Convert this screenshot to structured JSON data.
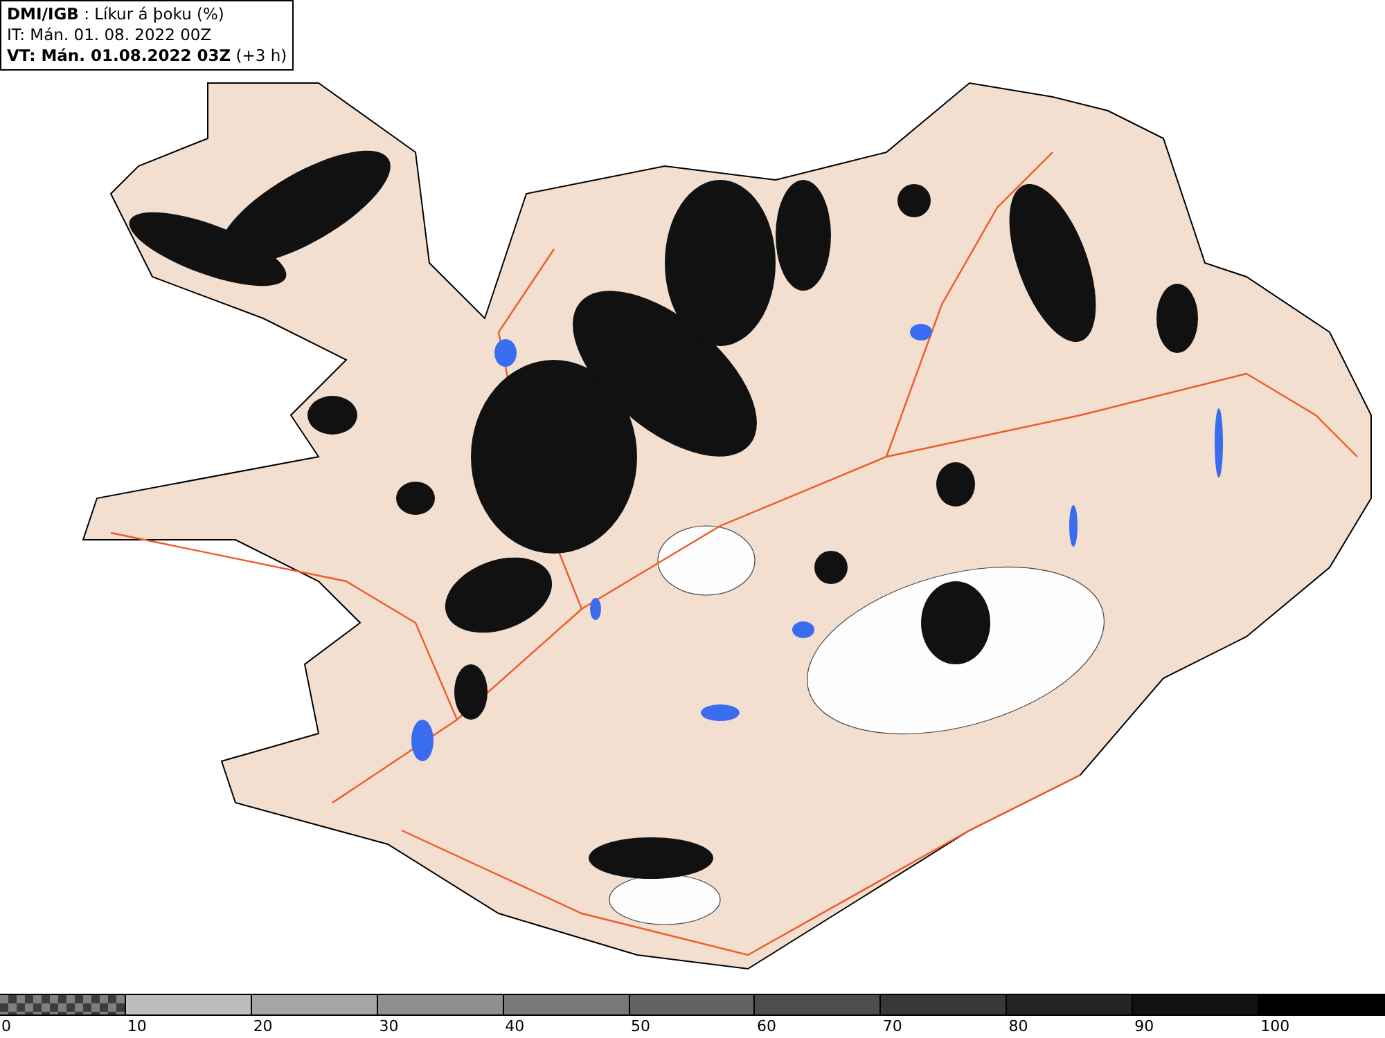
{
  "header": {
    "lines": [
      "**DMI/IGB** : Líkur á þoku (%)",
      "IT: Mán. 01. 08. 2022 00Z",
      "**VT: Mán. 01.08.2022 03Z** (+3 h)"
    ]
  },
  "legend": {
    "bins": [
      {
        "label": "0",
        "kind": "checker"
      },
      {
        "label": "10",
        "kind": "solid",
        "color": "#bdbdbd"
      },
      {
        "label": "20",
        "kind": "solid",
        "color": "#a6a6a6"
      },
      {
        "label": "30",
        "kind": "solid",
        "color": "#8f8f8f"
      },
      {
        "label": "40",
        "kind": "solid",
        "color": "#787878"
      },
      {
        "label": "50",
        "kind": "solid",
        "color": "#636363"
      },
      {
        "label": "60",
        "kind": "solid",
        "color": "#4d4d4d"
      },
      {
        "label": "70",
        "kind": "solid",
        "color": "#383838"
      },
      {
        "label": "80",
        "kind": "solid",
        "color": "#242424"
      },
      {
        "label": "90",
        "kind": "solid",
        "color": "#121212"
      },
      {
        "label": "100",
        "kind": "solid",
        "color": "#000000"
      }
    ]
  }
}
